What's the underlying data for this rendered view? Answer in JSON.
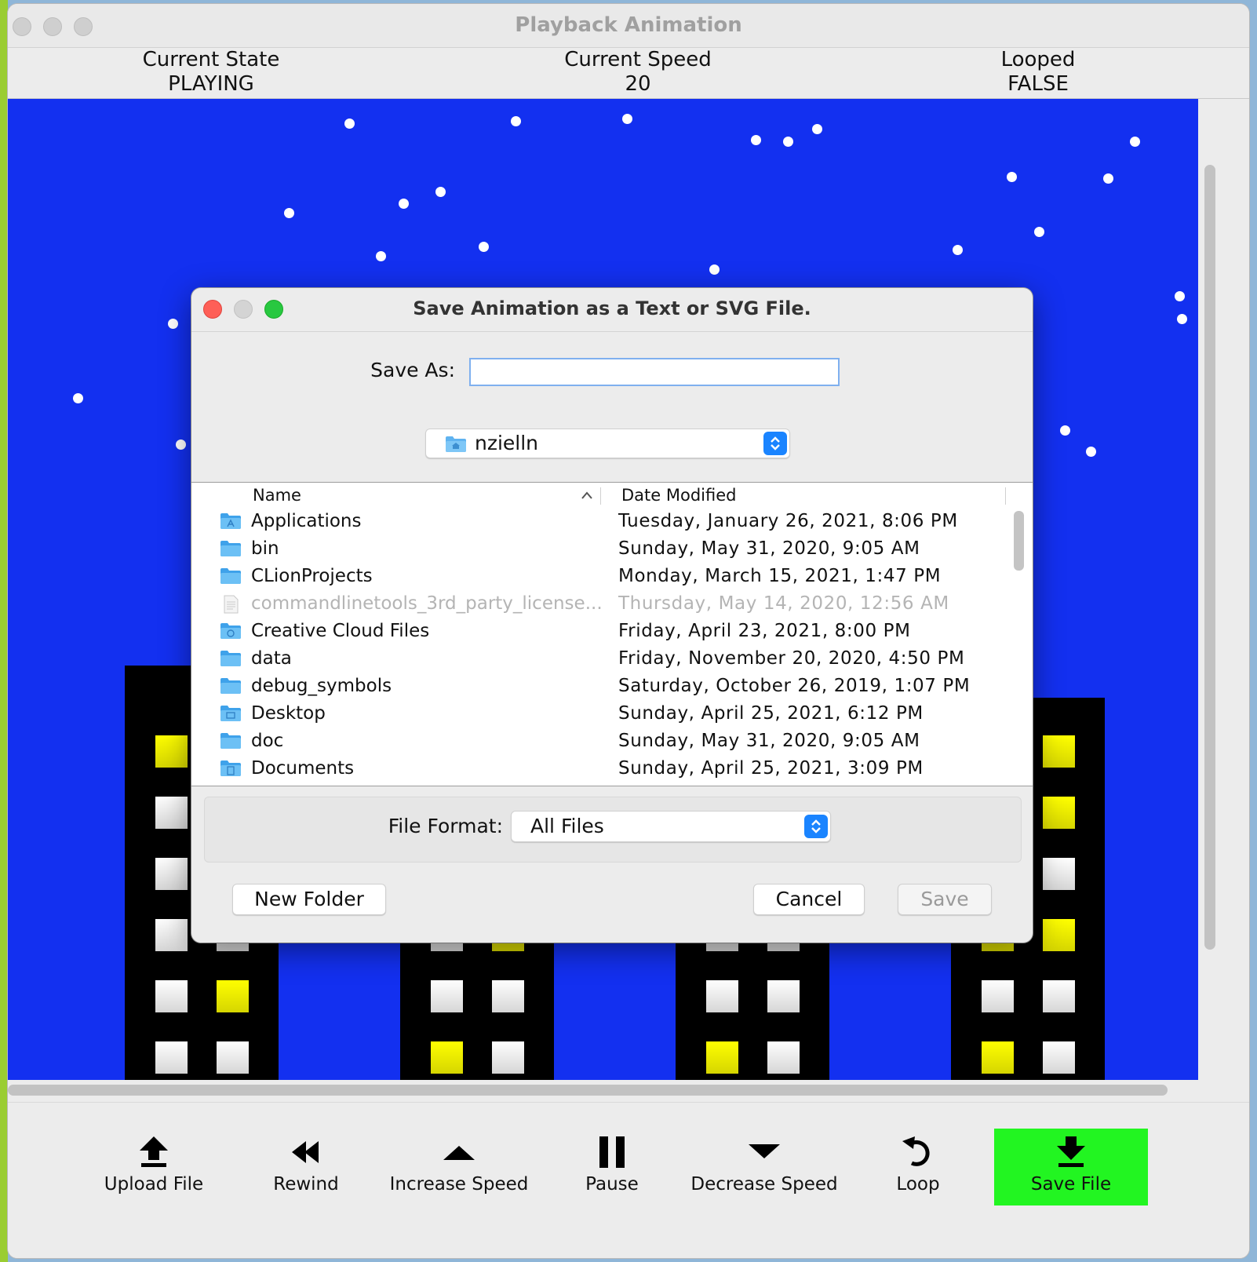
{
  "window": {
    "title": "Playback Animation"
  },
  "status": {
    "state_label": "Current State",
    "state_value": "PLAYING",
    "speed_label": "Current Speed",
    "speed_value": "20",
    "looped_label": "Looped",
    "looped_value": "FALSE"
  },
  "toolbar": {
    "upload": "Upload File",
    "rewind": "Rewind",
    "increase": "Increase Speed",
    "pause": "Pause",
    "decrease": "Decrease Speed",
    "loop": "Loop",
    "save": "Save File",
    "save_active_color": "#22f521"
  },
  "dialog": {
    "title": "Save Animation as a Text or SVG File.",
    "save_as_label": "Save As:",
    "save_as_value": "",
    "location": "nzielln",
    "columns": {
      "name": "Name",
      "date": "Date Modified"
    },
    "files": [
      {
        "name": "Applications",
        "date": "Tuesday, January 26, 2021, 8:06 PM",
        "icon": "apps-folder-icon",
        "disabled": false
      },
      {
        "name": "bin",
        "date": "Sunday, May 31, 2020, 9:05 AM",
        "icon": "folder-icon",
        "disabled": false
      },
      {
        "name": "CLionProjects",
        "date": "Monday, March 15, 2021, 1:47 PM",
        "icon": "folder-icon",
        "disabled": false
      },
      {
        "name": "commandlinetools_3rd_party_license...",
        "date": "Thursday, May 14, 2020, 12:56 AM",
        "icon": "document-icon",
        "disabled": true
      },
      {
        "name": "Creative Cloud Files",
        "date": "Friday, April 23, 2021, 8:00 PM",
        "icon": "cloud-folder-icon",
        "disabled": false
      },
      {
        "name": "data",
        "date": "Friday, November 20, 2020, 4:50 PM",
        "icon": "folder-icon",
        "disabled": false
      },
      {
        "name": "debug_symbols",
        "date": "Saturday, October 26, 2019, 1:07 PM",
        "icon": "folder-icon",
        "disabled": false
      },
      {
        "name": "Desktop",
        "date": "Sunday, April 25, 2021, 6:12 PM",
        "icon": "desktop-folder-icon",
        "disabled": false
      },
      {
        "name": "doc",
        "date": "Sunday, May 31, 2020, 9:05 AM",
        "icon": "folder-icon",
        "disabled": false
      },
      {
        "name": "Documents",
        "date": "Sunday, April 25, 2021, 3:09 PM",
        "icon": "documents-folder-icon",
        "disabled": false
      }
    ],
    "file_format_label": "File Format:",
    "file_format_value": "All Files",
    "new_folder": "New Folder",
    "cancel": "Cancel",
    "save": "Save"
  },
  "colors": {
    "sky": "#1330f0",
    "window_yellow": "#ffff00",
    "window_white": "#ffffff",
    "accent_blue": "#1a84ff"
  }
}
